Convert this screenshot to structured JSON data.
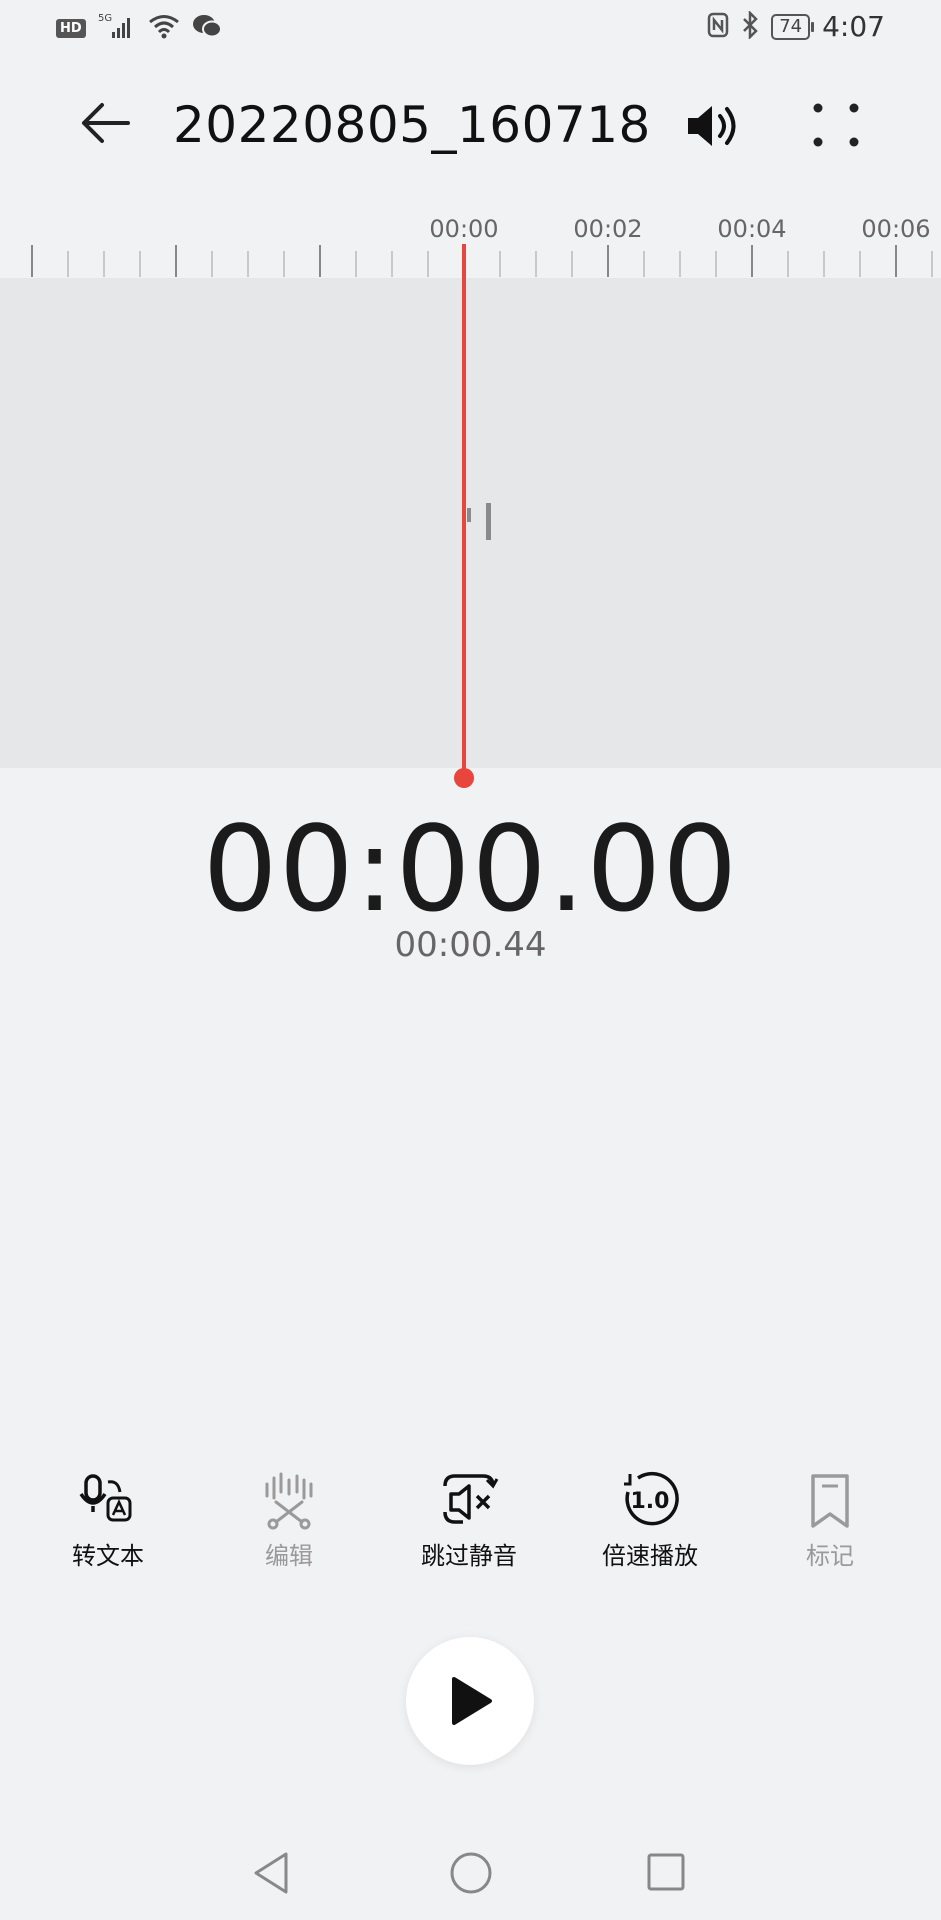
{
  "status_bar": {
    "hd": "HD",
    "network": "5G",
    "battery": "74",
    "time": "4:07"
  },
  "header": {
    "title": "20220805_160718",
    "back_icon": "back-arrow-icon",
    "speaker_icon": "speaker-icon",
    "more_icon": "more-dots-icon"
  },
  "ruler": {
    "labels": [
      "00:00",
      "00:02",
      "00:04",
      "00:06"
    ]
  },
  "timer": {
    "current": "00:00.00",
    "total": "00:00.44"
  },
  "toolbar": {
    "items": [
      {
        "label": "转文本",
        "icon": "speech-to-text-icon",
        "enabled": true
      },
      {
        "label": "编辑",
        "icon": "edit-cut-icon",
        "enabled": false
      },
      {
        "label": "跳过静音",
        "icon": "skip-silence-icon",
        "enabled": true
      },
      {
        "label": "倍速播放",
        "icon": "playback-speed-icon",
        "speed_value": "1.0",
        "enabled": true
      },
      {
        "label": "标记",
        "icon": "bookmark-icon",
        "enabled": false
      }
    ]
  },
  "colors": {
    "playhead": "#e8453c",
    "background": "#f1f2f4",
    "wave_area": "#e6e7e9",
    "disabled": "#9a9a9a"
  }
}
